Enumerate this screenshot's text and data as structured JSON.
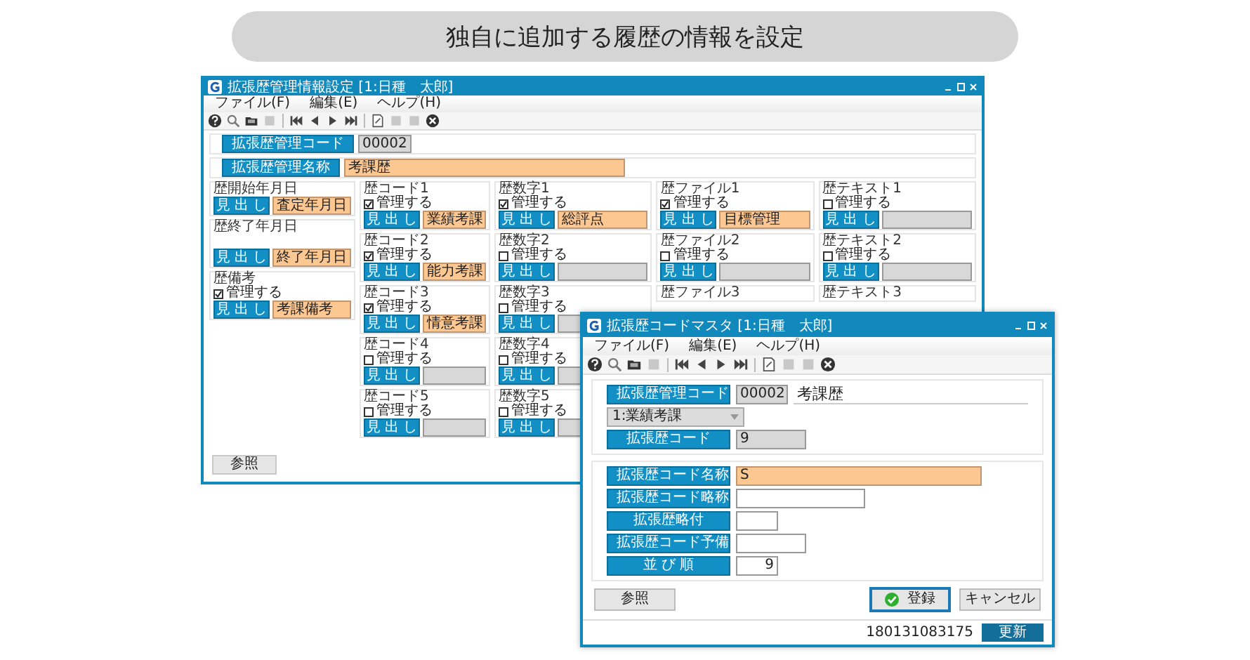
{
  "banner": {
    "title": "独自に追加する履歴の情報を設定"
  },
  "main_window": {
    "title": "拡張歴管理情報設定 [1:日種　太郎]",
    "menu": [
      "ファイル(F)",
      "編集(E)",
      "ヘルプ(H)"
    ],
    "code": {
      "label": "拡張歴管理コード",
      "value": "00002"
    },
    "name": {
      "label": "拡張歴管理名称",
      "value": "考課歴"
    },
    "columns": [
      [
        {
          "kind": "date",
          "title": "歴開始年月日",
          "heading": "見 出 し",
          "value": "査定年月日"
        },
        {
          "kind": "date",
          "title": "歴終了年月日",
          "heading": "見 出 し",
          "value": "終了年月日"
        },
        {
          "kind": "managed",
          "title": "歴備考",
          "checked": true,
          "check_label": "管理する",
          "heading": "見 出 し",
          "value": "考課備考"
        }
      ],
      [
        {
          "kind": "managed",
          "title": "歴コード1",
          "checked": true,
          "check_label": "管理する",
          "heading": "見 出 し",
          "value": "業績考課"
        },
        {
          "kind": "managed",
          "title": "歴コード2",
          "checked": true,
          "check_label": "管理する",
          "heading": "見 出 し",
          "value": "能力考課"
        },
        {
          "kind": "managed",
          "title": "歴コード3",
          "checked": true,
          "check_label": "管理する",
          "heading": "見 出 し",
          "value": "情意考課"
        },
        {
          "kind": "managed",
          "title": "歴コード4",
          "checked": false,
          "check_label": "管理する",
          "heading": "見 出 し"
        },
        {
          "kind": "managed",
          "title": "歴コード5",
          "checked": false,
          "check_label": "管理する",
          "heading": "見 出 し"
        }
      ],
      [
        {
          "kind": "managed",
          "title": "歴数字1",
          "checked": true,
          "check_label": "管理する",
          "heading": "見 出 し",
          "value": "総評点"
        },
        {
          "kind": "managed",
          "title": "歴数字2",
          "checked": false,
          "check_label": "管理する",
          "heading": "見 出 し"
        },
        {
          "kind": "managed",
          "title": "歴数字3",
          "checked": false,
          "check_label": "管理する",
          "heading": "見 出 し"
        },
        {
          "kind": "managed",
          "title": "歴数字4",
          "checked": false,
          "check_label": "管理する",
          "heading": "見 出 し"
        },
        {
          "kind": "managed",
          "title": "歴数字5",
          "checked": false,
          "check_label": "管理する",
          "heading": "見 出 し"
        }
      ],
      [
        {
          "kind": "managed",
          "title": "歴ファイル1",
          "checked": true,
          "check_label": "管理する",
          "heading": "見 出 し",
          "value": "目標管理"
        },
        {
          "kind": "managed",
          "title": "歴ファイル2",
          "checked": false,
          "check_label": "管理する",
          "heading": "見 出 し"
        },
        {
          "kind": "title_only",
          "title": "歴ファイル3"
        }
      ],
      [
        {
          "kind": "managed",
          "title": "歴テキスト1",
          "checked": false,
          "check_label": "管理する",
          "heading": "見 出 し"
        },
        {
          "kind": "managed",
          "title": "歴テキスト2",
          "checked": false,
          "check_label": "管理する",
          "heading": "見 出 し"
        },
        {
          "kind": "title_only",
          "title": "歴テキスト3"
        }
      ]
    ],
    "reference_button": "参照"
  },
  "dialog": {
    "title": "拡張歴コードマスタ [1:日種　太郎]",
    "menu": [
      "ファイル(F)",
      "編集(E)",
      "ヘルプ(H)"
    ],
    "code": {
      "label": "拡張歴管理コード",
      "value": "00002",
      "name": "考課歴"
    },
    "category": {
      "value": "1:業績考課"
    },
    "history_code": {
      "label": "拡張歴コード",
      "value": "9"
    },
    "fields": [
      {
        "label": "拡張歴コード名称",
        "value": "S",
        "required": true
      },
      {
        "label": "拡張歴コード略称",
        "required": false
      },
      {
        "label": "拡張歴略付",
        "required": false
      },
      {
        "label": "拡張歴コード予備",
        "required": false
      },
      {
        "label": "並 び 順",
        "value": "9",
        "required": false
      }
    ],
    "buttons": {
      "reference": "参照",
      "register": "登録",
      "cancel": "キャンセル"
    },
    "status": {
      "record": "180131083175",
      "update": "更新"
    }
  }
}
